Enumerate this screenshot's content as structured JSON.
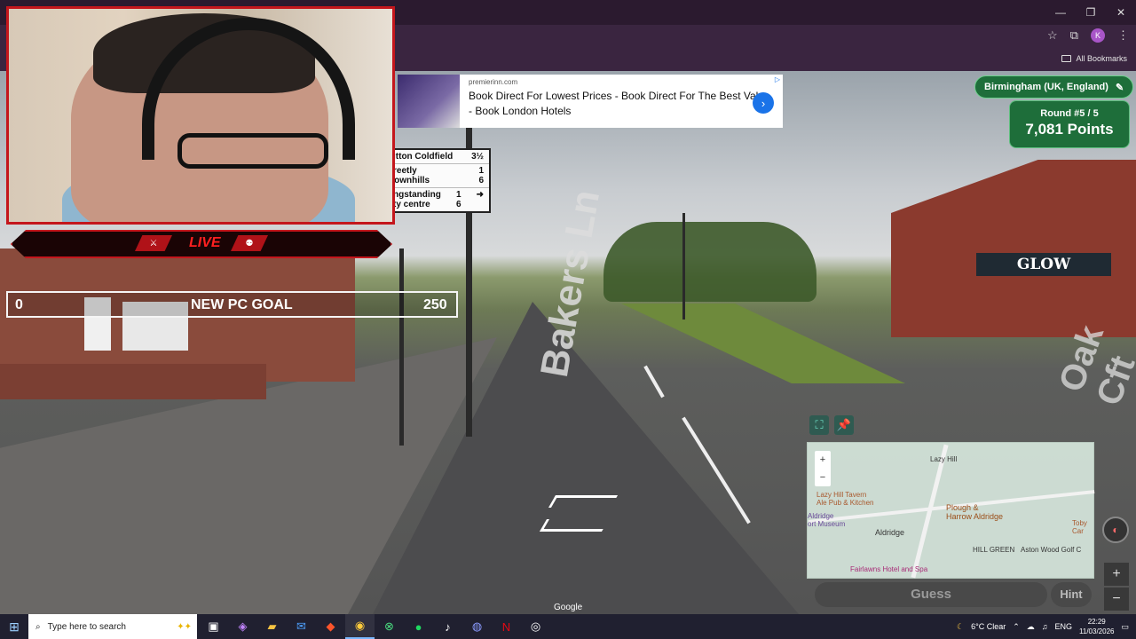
{
  "browser": {
    "window_controls": [
      "minimize",
      "restore",
      "close"
    ],
    "bookmarks_label": "All Bookmarks",
    "profile_initial": "K"
  },
  "ad": {
    "domain": "premierinn.com",
    "title": "Book Direct For Lowest Prices - Book Direct For The Best Value - Book London Hotels",
    "cta_icon": "chevron-right-icon"
  },
  "street_sign": {
    "rows": [
      {
        "place": "Sutton Coldfield",
        "dist": "3½"
      },
      {
        "place": "Streetly\nBrownhills",
        "dist": "1\n6"
      },
      {
        "place": "Kingstanding\nCity centre",
        "dist": "1\n6"
      }
    ]
  },
  "street": {
    "road_name": "Bakers Ln",
    "road_name_right": "Oak Cft",
    "shop_sign": "GLOW",
    "watermark": "Google"
  },
  "game": {
    "location": "Birmingham (UK, England)",
    "round_label": "Round #5 / 5",
    "points": "7,081 Points",
    "guess_label": "Guess",
    "hint_label": "Hint",
    "map_labels": {
      "lazy_hill": "Lazy Hill Tavern\nAle Pub & Kitchen",
      "plough": "Plough &\nHarrow Aldridge",
      "museum": "Aldridge\nort Museum",
      "aldridge": "Aldridge",
      "hill_green": "HILL GREEN",
      "aston_wood": "Aston Wood Golf C",
      "fairlawns": "Fairlawns Hotel and Spa",
      "toby": "Toby Car",
      "road": "Lazy Hill"
    }
  },
  "overlay": {
    "live_label": "LIVE",
    "goal_start": "0",
    "goal_title": "NEW PC GOAL",
    "goal_end": "250"
  },
  "taskbar": {
    "search_placeholder": "Type here to search",
    "weather": "6°C  Clear",
    "lang": "ENG",
    "time": "22:29",
    "date": "11/03/2026"
  }
}
